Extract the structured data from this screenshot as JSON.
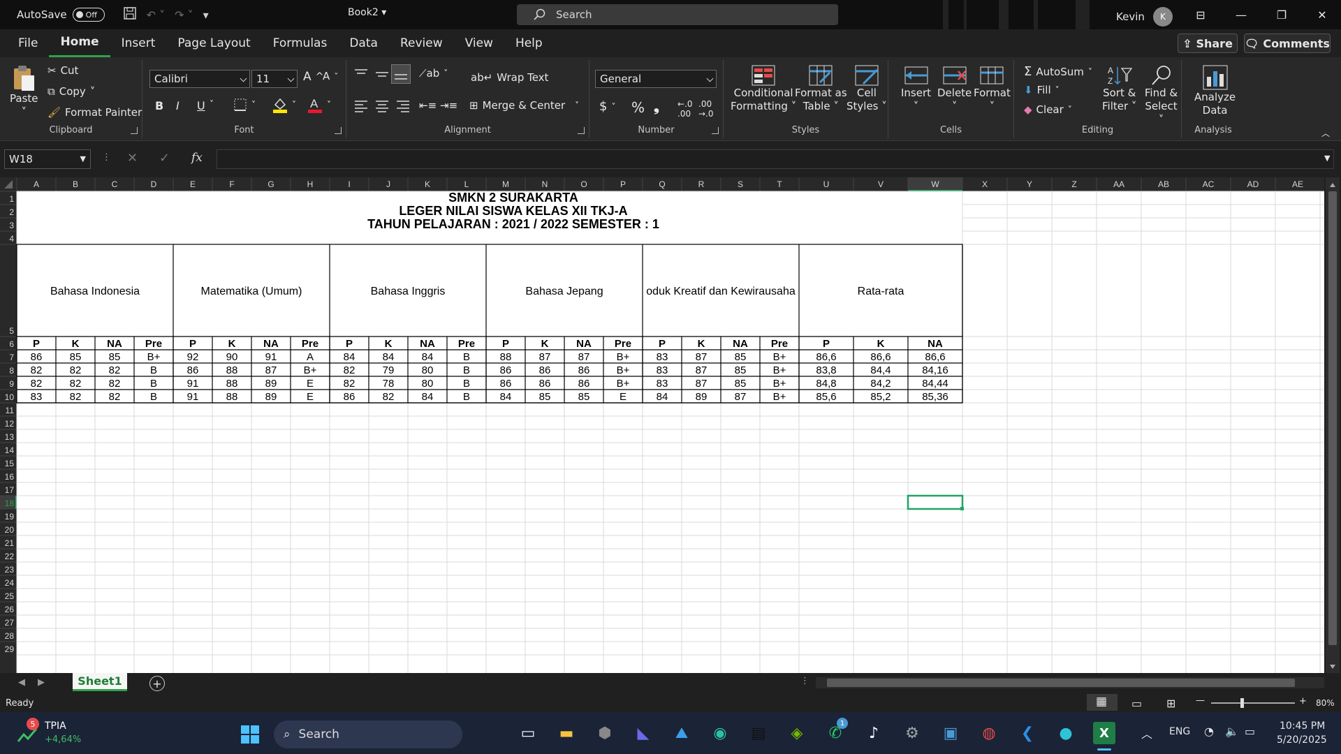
{
  "titlebar": {
    "autosave_label": "AutoSave",
    "autosave_state": "Off",
    "doc_title": "Book2",
    "search_placeholder": "Search",
    "user_name": "Kevin",
    "user_initial": "K"
  },
  "menu": {
    "items": [
      "File",
      "Home",
      "Insert",
      "Page Layout",
      "Formulas",
      "Data",
      "Review",
      "View",
      "Help"
    ],
    "active": "Home",
    "share": "Share",
    "comments": "Comments"
  },
  "ribbon": {
    "clipboard": {
      "label": "Clipboard",
      "paste": "Paste",
      "cut": "Cut",
      "copy": "Copy",
      "format_painter": "Format Painter"
    },
    "font": {
      "label": "Font",
      "font_name": "Calibri",
      "font_size": "11",
      "bold": "B",
      "italic": "I",
      "underline": "U"
    },
    "alignment": {
      "label": "Alignment",
      "wrap": "Wrap Text",
      "merge": "Merge & Center"
    },
    "number": {
      "label": "Number",
      "format": "General"
    },
    "styles": {
      "label": "Styles",
      "conditional": [
        "Conditional",
        "Formatting"
      ],
      "format_table": [
        "Format as",
        "Table"
      ],
      "cell_styles": [
        "Cell",
        "Styles"
      ]
    },
    "cells": {
      "label": "Cells",
      "insert": "Insert",
      "delete": "Delete",
      "format": "Format"
    },
    "editing": {
      "label": "Editing",
      "autosum": "AutoSum",
      "fill": "Fill",
      "clear": "Clear",
      "sort": [
        "Sort &",
        "Filter"
      ],
      "find": [
        "Find &",
        "Select"
      ]
    },
    "analysis": {
      "label": "Analysis",
      "analyze": [
        "Analyze",
        "Data"
      ]
    }
  },
  "formula": {
    "name_box": "W18",
    "fx": "fx"
  },
  "sheet": {
    "columns": [
      "A",
      "B",
      "C",
      "D",
      "E",
      "F",
      "G",
      "H",
      "I",
      "J",
      "K",
      "L",
      "M",
      "N",
      "O",
      "P",
      "Q",
      "R",
      "S",
      "T",
      "U",
      "V",
      "W",
      "X",
      "Y",
      "Z",
      "AA",
      "AB",
      "AC",
      "AD",
      "AE"
    ],
    "rows": [
      "1",
      "2",
      "3",
      "4",
      "5",
      "6",
      "7",
      "8",
      "9",
      "10",
      "11",
      "12",
      "13",
      "14",
      "15",
      "16",
      "17",
      "18",
      "19",
      "20",
      "21",
      "22",
      "23",
      "24",
      "25",
      "26",
      "27",
      "28",
      "29"
    ],
    "title1": "SMKN 2 SURAKARTA",
    "title2": "LEGER NILAI SISWA KELAS XII TKJ-A",
    "title3": "TAHUN PELAJARAN : 2021 / 2022 SEMESTER : 1",
    "subjects": [
      "Bahasa Indonesia",
      "Matematika (Umum)",
      "Bahasa Inggris",
      "Bahasa Jepang",
      "oduk Kreatif dan Kewirausaha",
      "Rata-rata"
    ],
    "subheaders": [
      "P",
      "K",
      "NA",
      "Pre",
      "P",
      "K",
      "NA",
      "Pre",
      "P",
      "K",
      "NA",
      "Pre",
      "P",
      "K",
      "NA",
      "Pre",
      "P",
      "K",
      "NA",
      "Pre",
      "P",
      "K",
      "NA"
    ],
    "data": [
      [
        "86",
        "85",
        "85",
        "B+",
        "92",
        "90",
        "91",
        "A",
        "84",
        "84",
        "84",
        "B",
        "88",
        "87",
        "87",
        "B+",
        "83",
        "87",
        "85",
        "B+",
        "86,6",
        "86,6",
        "86,6"
      ],
      [
        "82",
        "82",
        "82",
        "B",
        "86",
        "88",
        "87",
        "B+",
        "82",
        "79",
        "80",
        "B",
        "86",
        "86",
        "86",
        "B+",
        "83",
        "87",
        "85",
        "B+",
        "83,8",
        "84,4",
        "84,16"
      ],
      [
        "82",
        "82",
        "82",
        "B",
        "91",
        "88",
        "89",
        "E",
        "82",
        "78",
        "80",
        "B",
        "86",
        "86",
        "86",
        "B+",
        "83",
        "87",
        "85",
        "B+",
        "84,8",
        "84,2",
        "84,44"
      ],
      [
        "83",
        "82",
        "82",
        "B",
        "91",
        "88",
        "89",
        "E",
        "86",
        "82",
        "84",
        "B",
        "84",
        "85",
        "85",
        "E",
        "84",
        "89",
        "87",
        "B+",
        "85,6",
        "85,2",
        "85,36"
      ]
    ],
    "tab": "Sheet1"
  },
  "status": {
    "ready": "Ready",
    "zoom": "80%"
  },
  "taskbar": {
    "stock_name": "TPIA",
    "stock_change": "+4,64%",
    "stock_badge": "5",
    "search": "Search",
    "lang": "ENG",
    "time": "10:45 PM",
    "date": "5/20/2025",
    "whatsapp_badge": "1"
  },
  "colors": {
    "accent": "#2fa24a",
    "selection": "#21a366"
  }
}
